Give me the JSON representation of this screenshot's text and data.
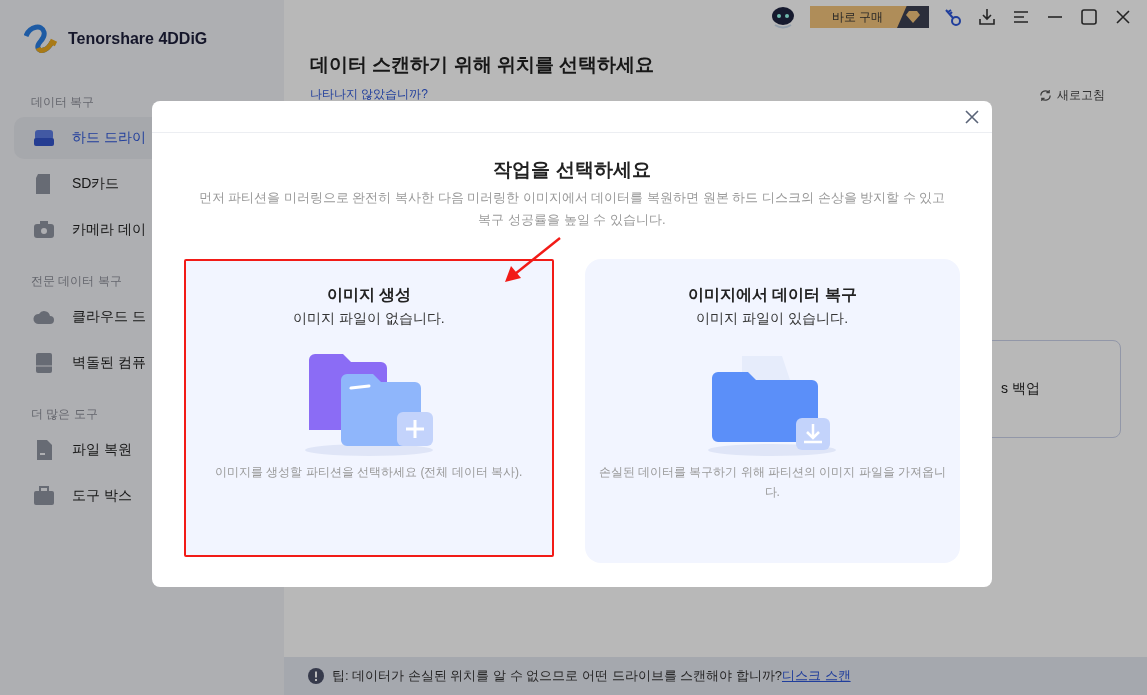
{
  "app": {
    "name": "Tenorshare 4DDiG"
  },
  "sidebar": {
    "sections": [
      {
        "title": "데이터 복구",
        "items": [
          {
            "label": "하드 드라이",
            "kind": "drive",
            "selected": true
          },
          {
            "label": "SD카드",
            "kind": "sd",
            "selected": false
          },
          {
            "label": "카메라 데이",
            "kind": "camera",
            "selected": false
          }
        ]
      },
      {
        "title": "전문 데이터 복구",
        "items": [
          {
            "label": "클라우드 드",
            "kind": "cloud",
            "selected": false
          },
          {
            "label": "벽돌된 컴퓨",
            "kind": "crashed",
            "selected": false
          }
        ]
      },
      {
        "title": "더 많은 도구",
        "items": [
          {
            "label": "파일 복원",
            "kind": "file",
            "selected": false
          },
          {
            "label": "도구 박스",
            "kind": "toolbox",
            "selected": false
          }
        ]
      }
    ]
  },
  "topbar": {
    "buy_button": "바로 구매"
  },
  "main": {
    "title": "데이터 스캔하기 위해 위치를 선택하세요",
    "help_link": "나타나지 않았습니까?",
    "refresh": "새로고침",
    "card_fragment": "s 백업"
  },
  "dialog": {
    "title": "작업을 선택하세요",
    "description": "먼저 파티션을 미러링으로 완전히 복사한 다음 미러링한 이미지에서 데이터를 복원하면 원본 하드 디스크의 손상을 방지할 수 있고 복구 성공률을 높일 수 있습니다.",
    "options": [
      {
        "kind": "create",
        "title": "이미지 생성",
        "subtitle": "이미지 파일이 없습니다.",
        "note": "이미지를 생성할 파티션을 선택하세요 (전체 데이터 복사).",
        "selected": true
      },
      {
        "kind": "import",
        "title": "이미지에서 데이터 복구",
        "subtitle": "이미지 파일이 있습니다.",
        "note": "손실된 데이터를 복구하기 위해 파티션의 이미지 파일을 가져옵니다.",
        "selected": false
      }
    ]
  },
  "tip": {
    "text": "팁: 데이터가 손실된 위치를 알 수 없으므로 어떤 드라이브를 스캔해야 합니까?",
    "link": "디스크 스캔"
  }
}
